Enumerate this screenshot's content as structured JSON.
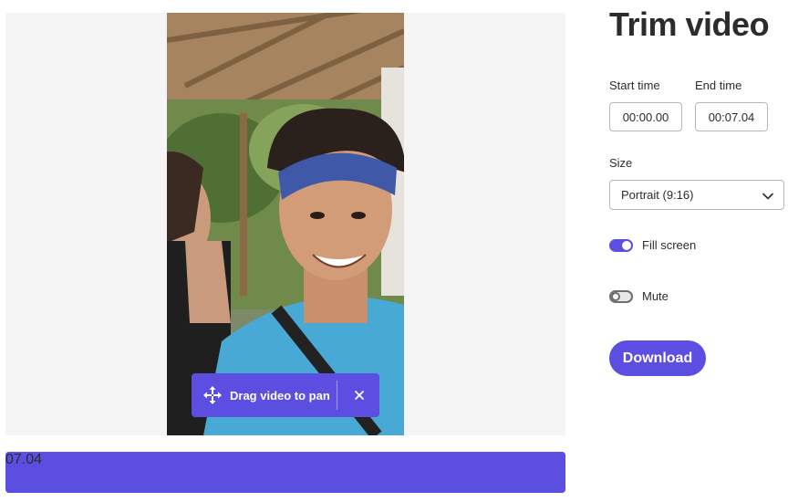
{
  "panel": {
    "title": "Trim video",
    "start_time_label": "Start time",
    "end_time_label": "End time",
    "start_time_value": "00:00.00",
    "end_time_value": "00:07.04",
    "size_label": "Size",
    "size_value": "Portrait (9:16)",
    "fill_screen_label": "Fill screen",
    "fill_screen_on": true,
    "mute_label": "Mute",
    "mute_on": false,
    "download_label": "Download"
  },
  "preview": {
    "pan_hint": "Drag video to pan",
    "close_icon": "close-icon",
    "move_icon": "move-arrows-icon"
  },
  "timeline": {
    "duration_badge": "07.04"
  },
  "colors": {
    "accent": "#5c4ee0",
    "text": "#2c2c2c",
    "preview_bg": "#f5f5f5"
  }
}
